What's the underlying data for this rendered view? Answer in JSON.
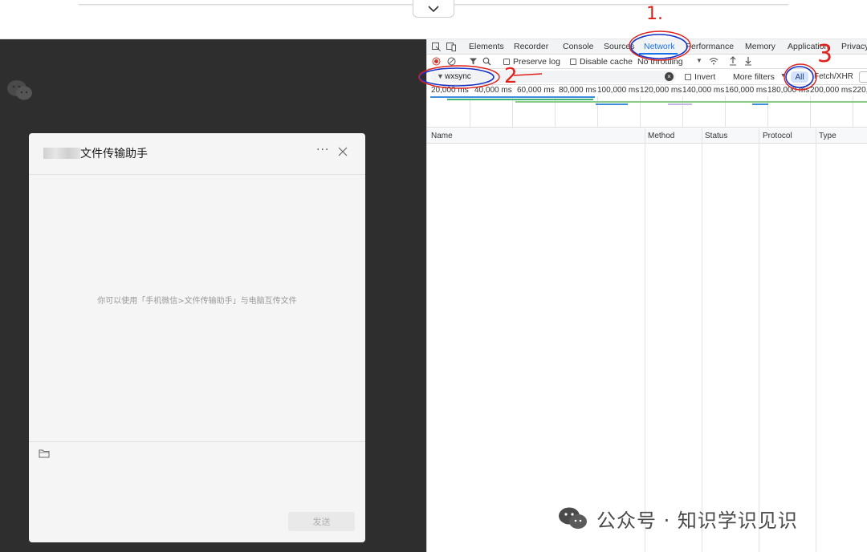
{
  "wechat": {
    "chat_title": "文件传输助手",
    "more_glyph": "···",
    "empty_hint": "你可以使用「手机微信>文件传输助手」与电脑互传文件",
    "send_label": "发送"
  },
  "devtools": {
    "tabs": [
      "Elements",
      "Recorder",
      "Console",
      "Sources",
      "Network",
      "Performance",
      "Memory",
      "Application",
      "Privacy"
    ],
    "active_tab": "Network",
    "toolbar": {
      "preserve_log": "Preserve log",
      "disable_cache": "Disable cache",
      "throttling": "No throttling"
    },
    "filter": {
      "value": "wxsync",
      "invert_label": "Invert",
      "more_filters_label": "More filters",
      "type_all": "All",
      "type_fetch_xhr": "Fetch/XHR"
    },
    "timeline_ticks": [
      "20,000 ms",
      "40,000 ms",
      "60,000 ms",
      "80,000 ms",
      "100,000 ms",
      "120,000 ms",
      "140,000 ms",
      "160,000 ms",
      "180,000 ms",
      "200,000 ms",
      "220,"
    ],
    "columns": [
      "Name",
      "Method",
      "Status",
      "Protocol",
      "Type"
    ]
  },
  "annotations": {
    "step1": "1.",
    "step2": "2",
    "step3": "3"
  },
  "watermark": "公众号 · 知识学识见识",
  "colors": {
    "wechat_bg": "#2e2e2e",
    "chat_bg": "#f5f5f5",
    "devtools_accent": "#1a73e8",
    "annotation_red": "#e0201a",
    "annotation_blue": "#1432c8"
  }
}
